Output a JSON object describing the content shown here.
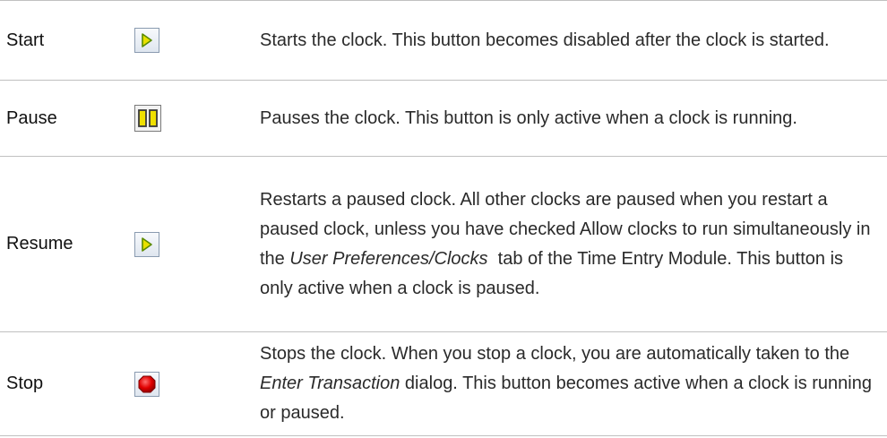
{
  "rows": [
    {
      "name": "Start",
      "icon": "play-icon",
      "description": "Starts the clock. This button becomes disabled after the clock is started."
    },
    {
      "name": "Pause",
      "icon": "pause-icon",
      "description": "Pauses the clock. This button is only active when a clock is running."
    },
    {
      "name": "Resume",
      "icon": "play-icon",
      "description_parts": {
        "before": "Restarts a paused clock. All other clocks are paused when you restart a paused clock, unless you have checked Allow clocks to run simultaneously in the ",
        "emphasis": "User Preferences/Clocks",
        "after": "  tab of the Time Entry Module. This button is only active when a clock is paused."
      }
    },
    {
      "name": "Stop",
      "icon": "stop-icon",
      "description_parts": {
        "before": "Stops the clock. When you stop a clock, you are automatically taken to the ",
        "emphasis": "Enter Transaction",
        "after": " dialog. This button becomes active when a clock is running or paused."
      }
    }
  ],
  "colors": {
    "play_fill": "#e8e000",
    "play_stroke": "#5a8a00",
    "pause_fill": "#f0e000",
    "pause_stroke": "#3a3a3a",
    "stop_fill": "#e00000",
    "divider": "#c0c0c0"
  }
}
